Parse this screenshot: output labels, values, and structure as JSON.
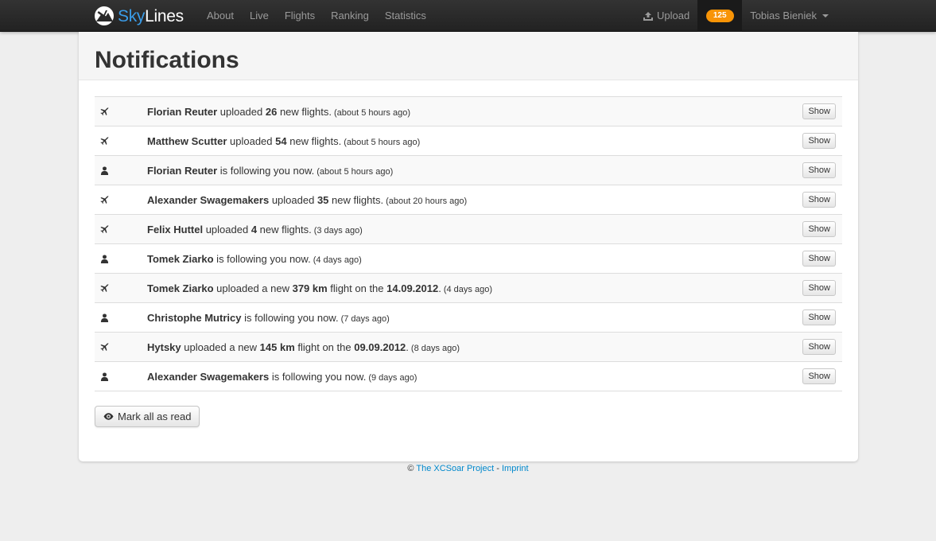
{
  "brand": {
    "part1": "Sky",
    "part2": "Lines"
  },
  "nav": {
    "items": [
      {
        "label": "About"
      },
      {
        "label": "Live"
      },
      {
        "label": "Flights"
      },
      {
        "label": "Ranking"
      },
      {
        "label": "Statistics"
      }
    ],
    "upload_label": "Upload",
    "badge_count": "125",
    "user_name": "Tobias Bieniek"
  },
  "page": {
    "title": "Notifications"
  },
  "notifications": [
    {
      "type": "flight",
      "icon": "plane-icon",
      "user": "Florian Reuter",
      "t1": " uploaded ",
      "b2": "26",
      "t2": " new flights.",
      "b3": "",
      "t3": "",
      "time": "(about 5 hours ago)",
      "button": "Show"
    },
    {
      "type": "flight",
      "icon": "plane-icon",
      "user": "Matthew Scutter",
      "t1": " uploaded ",
      "b2": "54",
      "t2": " new flights.",
      "b3": "",
      "t3": "",
      "time": "(about 5 hours ago)",
      "button": "Show"
    },
    {
      "type": "follow",
      "icon": "user-icon",
      "user": "Florian Reuter",
      "t1": " is following you now.",
      "b2": "",
      "t2": "",
      "b3": "",
      "t3": "",
      "time": "(about 5 hours ago)",
      "button": "Show"
    },
    {
      "type": "flight",
      "icon": "plane-icon",
      "user": "Alexander Swagemakers",
      "t1": " uploaded ",
      "b2": "35",
      "t2": " new flights.",
      "b3": "",
      "t3": "",
      "time": "(about 20 hours ago)",
      "button": "Show"
    },
    {
      "type": "flight",
      "icon": "plane-icon",
      "user": "Felix Huttel",
      "t1": " uploaded ",
      "b2": "4",
      "t2": " new flights.",
      "b3": "",
      "t3": "",
      "time": "(3 days ago)",
      "button": "Show"
    },
    {
      "type": "follow",
      "icon": "user-icon",
      "user": "Tomek Ziarko",
      "t1": " is following you now.",
      "b2": "",
      "t2": "",
      "b3": "",
      "t3": "",
      "time": "(4 days ago)",
      "button": "Show"
    },
    {
      "type": "flight",
      "icon": "plane-icon",
      "user": "Tomek Ziarko",
      "t1": " uploaded a new ",
      "b2": "379 km",
      "t2": " flight on the ",
      "b3": "14.09.2012",
      "t3": ".",
      "time": "(4 days ago)",
      "button": "Show"
    },
    {
      "type": "follow",
      "icon": "user-icon",
      "user": "Christophe Mutricy",
      "t1": " is following you now.",
      "b2": "",
      "t2": "",
      "b3": "",
      "t3": "",
      "time": "(7 days ago)",
      "button": "Show"
    },
    {
      "type": "flight",
      "icon": "plane-icon",
      "user": "Hytsky",
      "t1": " uploaded a new ",
      "b2": "145 km",
      "t2": " flight on the ",
      "b3": "09.09.2012",
      "t3": ".",
      "time": "(8 days ago)",
      "button": "Show"
    },
    {
      "type": "follow",
      "icon": "user-icon",
      "user": "Alexander Swagemakers",
      "t1": " is following you now.",
      "b2": "",
      "t2": "",
      "b3": "",
      "t3": "",
      "time": "(9 days ago)",
      "button": "Show"
    }
  ],
  "actions": {
    "mark_all_label": "Mark all as read"
  },
  "footer": {
    "copyright": "©",
    "project_link": "The XCSoar Project",
    "separator": "-",
    "imprint_link": "Imprint"
  },
  "colors": {
    "accent": "#0088cc",
    "badge": "#f89406",
    "brand_blue": "#3a9ce8"
  }
}
